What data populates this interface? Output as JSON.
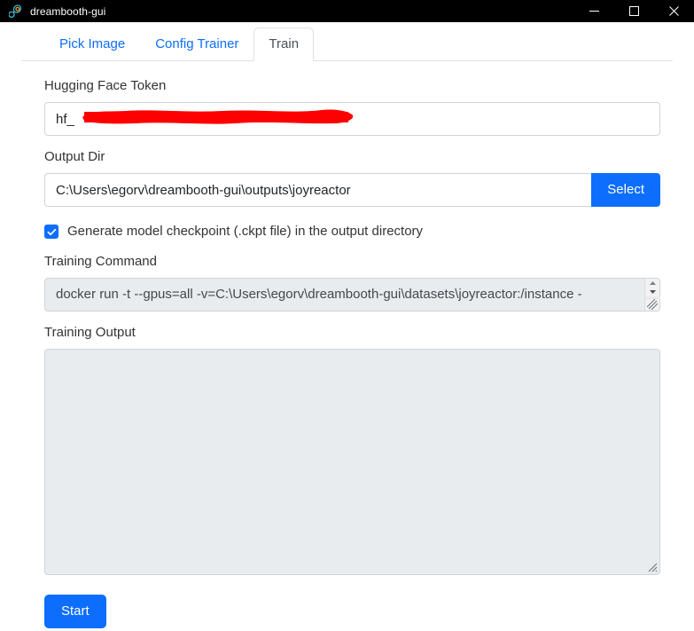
{
  "window": {
    "title": "dreambooth-gui",
    "icon": "app-icon",
    "controls": {
      "minimize": "minimize",
      "maximize": "maximize",
      "close": "close"
    }
  },
  "tabs": [
    {
      "label": "Pick Image",
      "active": false
    },
    {
      "label": "Config Trainer",
      "active": false
    },
    {
      "label": "Train",
      "active": true
    }
  ],
  "form": {
    "token": {
      "label": "Hugging Face Token",
      "value": "hf_",
      "placeholder": "",
      "redacted": true
    },
    "output_dir": {
      "label": "Output Dir",
      "value": "C:\\Users\\egorv\\dreambooth-gui\\outputs\\joyreactor",
      "placeholder": "",
      "select_button": "Select"
    },
    "checkpoint": {
      "label": "Generate model checkpoint (.ckpt file) in the output directory",
      "checked": true
    },
    "training_command": {
      "label": "Training Command",
      "value": "docker run -t --gpus=all -v=C:\\Users\\egorv\\dreambooth-gui\\datasets\\joyreactor:/instance -"
    },
    "training_output": {
      "label": "Training Output",
      "value": "",
      "placeholder": ""
    },
    "start_button": "Start"
  },
  "colors": {
    "accent": "#0d6efd",
    "titlebar": "#000000",
    "redaction": "#ff0000",
    "field_disabled": "#e9ecef",
    "token_field": "#eaeef7"
  }
}
